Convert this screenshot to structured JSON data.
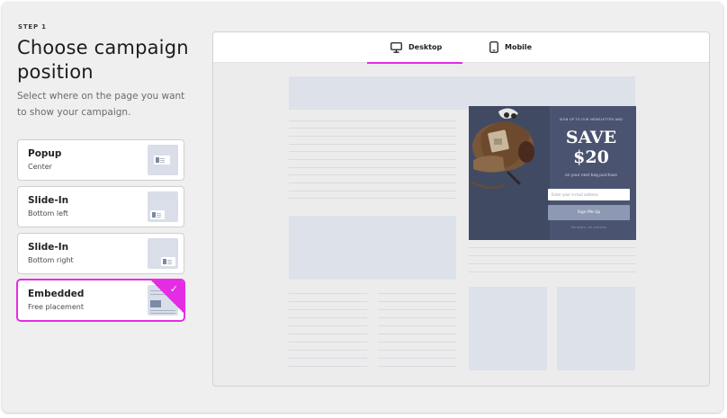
{
  "header": {
    "step": "STEP 1",
    "title": "Choose campaign position",
    "subtitle": "Select where on the page you want to show your campaign."
  },
  "options": [
    {
      "name": "Popup",
      "desc": "Center",
      "selected": false
    },
    {
      "name": "Slide-In",
      "desc": "Bottom left",
      "selected": false
    },
    {
      "name": "Slide-In",
      "desc": "Bottom right",
      "selected": false
    },
    {
      "name": "Embedded",
      "desc": "Free placement",
      "selected": true,
      "check": "✓"
    }
  ],
  "preview": {
    "tabs": [
      {
        "label": "Desktop",
        "icon": "monitor-icon",
        "active": true
      },
      {
        "label": "Mobile",
        "icon": "phone-icon",
        "active": false
      }
    ],
    "campaign": {
      "top_text": "SIGN UP TO OUR NEWSLETTER AND",
      "headline_1": "SAVE",
      "headline_2": "$20",
      "subtext": "on your next bag purchase",
      "input_placeholder": "Enter your e-mail address",
      "button_label": "Sign Me Up",
      "footer_text": "No spam, we promise"
    }
  },
  "colors": {
    "accent": "#e52ce5",
    "campaign_bg": "#4a5470",
    "placeholder_block": "#dde1ea"
  }
}
